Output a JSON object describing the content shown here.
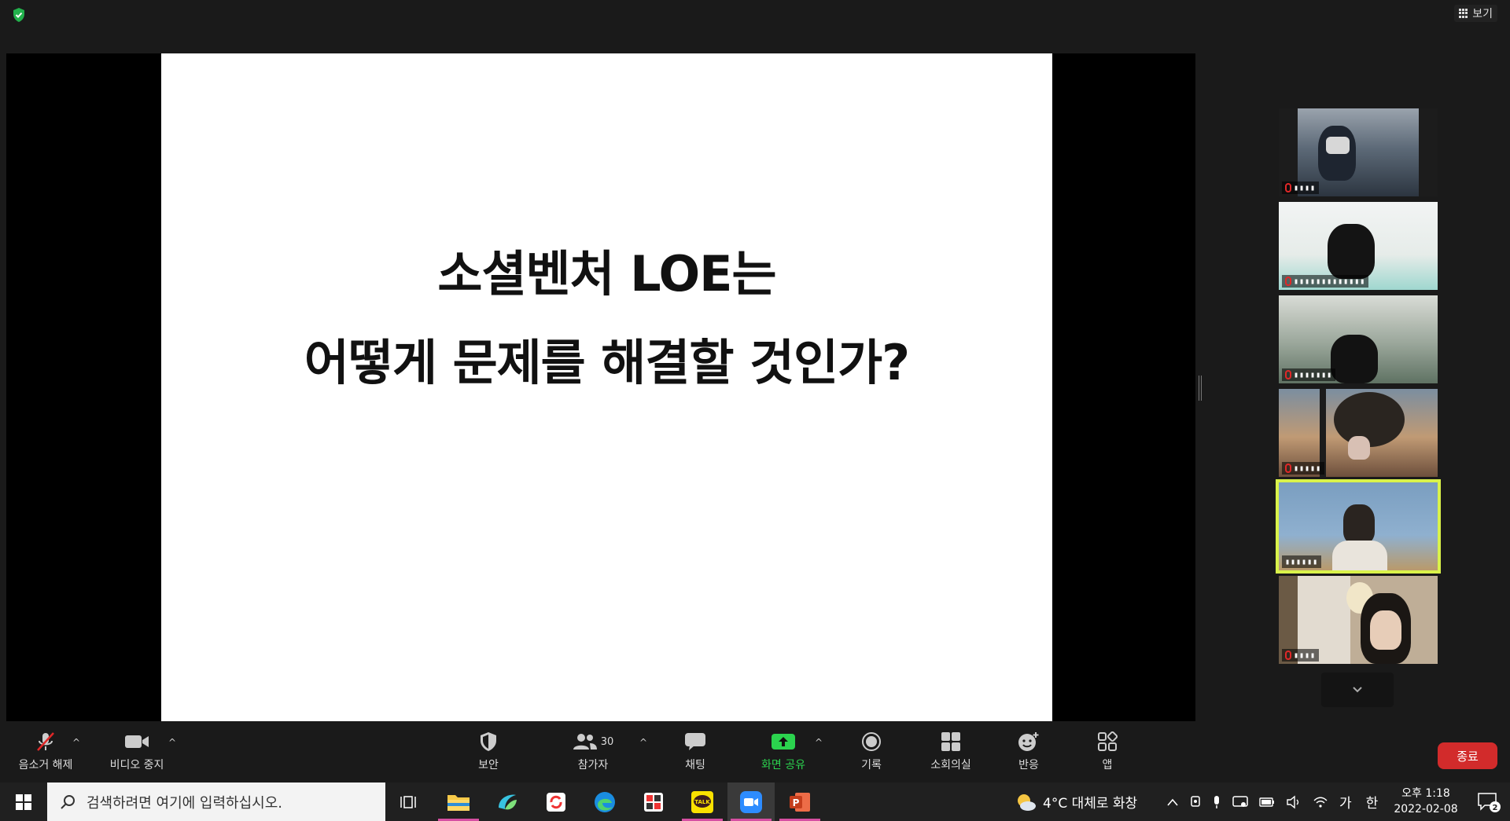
{
  "window": {
    "view_label": "보기"
  },
  "slide": {
    "line1": "소셜벤처 LOE는",
    "line2": "어떻게 문제를 해결할 것인가?"
  },
  "gallery": {
    "tiles": [
      {
        "name": "▮▮▮▮",
        "active": false
      },
      {
        "name": "▮▮▮▮▮▮▮▮▮▮▮▮▮",
        "active": false
      },
      {
        "name": "▮▮▮▮▮▮▮",
        "active": false
      },
      {
        "name": "▮▮▮▮▮",
        "active": false
      },
      {
        "name": "▮▮▮▮▮▮",
        "active": true
      },
      {
        "name": "▮▮▮▮",
        "active": false
      }
    ],
    "more_icon": "chevron-down-icon"
  },
  "controls": {
    "unmute": "음소거 해제",
    "stop_video": "비디오 중지",
    "security": "보안",
    "participants": "참가자",
    "participants_count": "30",
    "chat": "채팅",
    "share_screen": "화면 공유",
    "record": "기록",
    "breakout": "소회의실",
    "reactions": "반응",
    "apps": "앱",
    "end": "종료"
  },
  "taskbar": {
    "search_placeholder": "검색하려면 여기에 입력하십시오.",
    "weather": "4°C  대체로 화창",
    "ime": "가",
    "ime2": "한",
    "time": "오후 1:18",
    "date": "2022-02-08",
    "notif_count": "2"
  },
  "colors": {
    "accent_green": "#2bd34e",
    "end_red": "#d22b2b",
    "active_speaker": "#d9f24a",
    "taskbar_open_indicator": "#d64fa2"
  }
}
